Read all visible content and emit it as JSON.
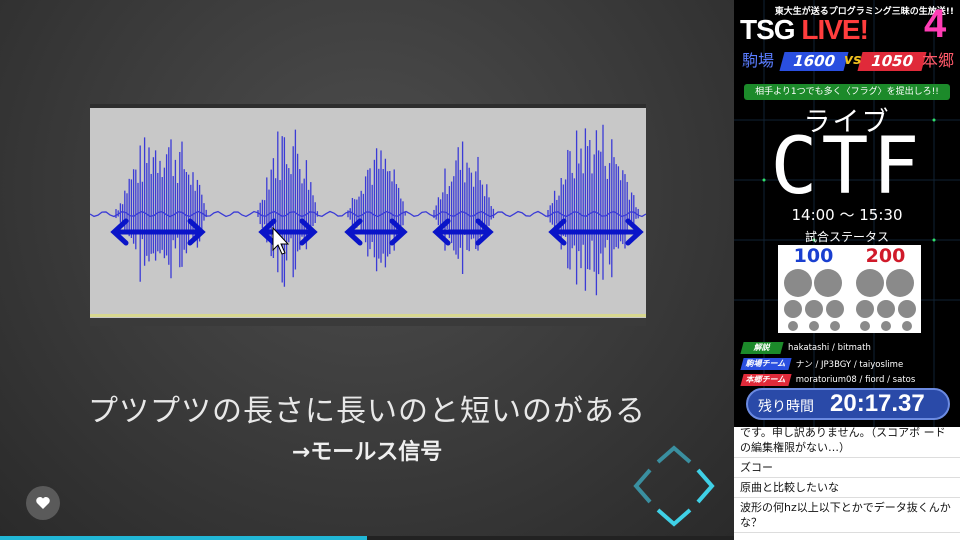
{
  "slide": {
    "caption": "プツプツの長さに長いのと短いのがある",
    "subcaption": "→モールス信号",
    "progress_percent": 50
  },
  "panel": {
    "tagline": "東大生が送るプログラミング三昧の生放送!!",
    "show_title_a": "TSG ",
    "show_title_b": "LIVE!",
    "show_number": "4",
    "team_left_name": "駒場",
    "team_left_score": "1600",
    "vs": "vs",
    "team_right_score": "1050",
    "team_right_name": "本郷",
    "objective": "相手より1つでも多く〈フラグ〉を提出しろ!!",
    "live_label": "ライブ",
    "ctf_label": "CTF",
    "time_range": "14:00 〜 15:30",
    "status_label": "試合ステータス",
    "status_left": "100",
    "status_right": "200",
    "credits": [
      {
        "tag": "解説",
        "names": "hakatashi / bitmath",
        "color": "#1c8a2a"
      },
      {
        "tag": "駒場チーム",
        "names": "ナン / JP3BGY / taiyoslime",
        "color": "#2a4fe0"
      },
      {
        "tag": "本郷チーム",
        "names": "moratorium08 / fiord / satos",
        "color": "#e02a3a"
      }
    ],
    "timer_label": "残り時間",
    "timer_value": "20:17.37"
  },
  "chat": [
    "です。申し訳ありません。（スコアボ ードの編集権限がない…）",
    "ズコー",
    "原曲と比較したいな",
    "波形の何hz以上以下とかでデータ抜くんかな？"
  ],
  "colors": {
    "accent": "#21b7d6",
    "wave": "#3b3bd6",
    "arrow": "#0a14c8"
  }
}
